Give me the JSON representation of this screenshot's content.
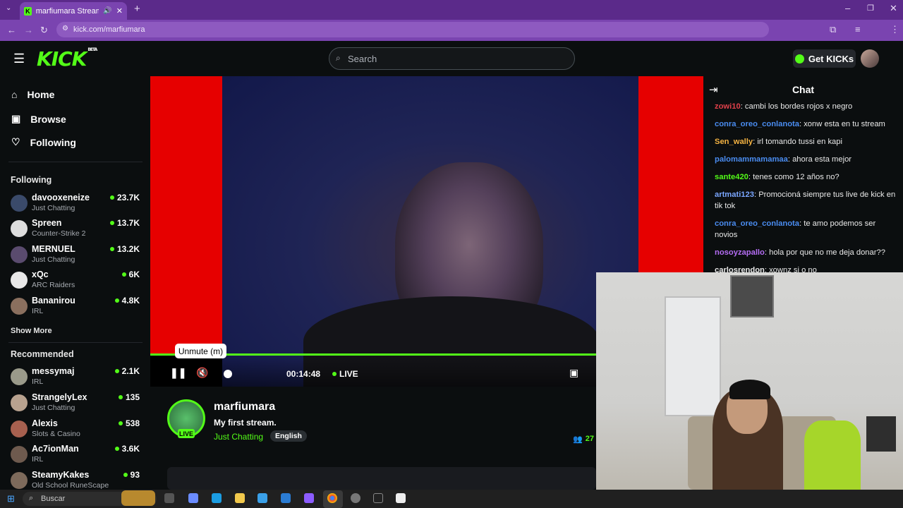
{
  "browser": {
    "tab_title": "marfiumara Stream - Watch",
    "url": "kick.com/marfiumara"
  },
  "header": {
    "logo": "KICK",
    "logo_badge": "BETA",
    "search_placeholder": "Search",
    "get_kicks": "Get KICKs"
  },
  "sidebar": {
    "nav": [
      {
        "label": "Home",
        "icon": "home-icon"
      },
      {
        "label": "Browse",
        "icon": "browse-icon"
      },
      {
        "label": "Following",
        "icon": "heart-icon"
      }
    ],
    "following_title": "Following",
    "following": [
      {
        "name": "davooxeneize",
        "category": "Just Chatting",
        "viewers": "23.7K"
      },
      {
        "name": "Spreen",
        "category": "Counter-Strike 2",
        "viewers": "13.7K"
      },
      {
        "name": "MERNUEL",
        "category": "Just Chatting",
        "viewers": "13.2K"
      },
      {
        "name": "xQc",
        "category": "ARC Raiders",
        "viewers": "6K"
      },
      {
        "name": "Bananirou",
        "category": "IRL",
        "viewers": "4.8K"
      }
    ],
    "show_more": "Show More",
    "recommended_title": "Recommended",
    "recommended": [
      {
        "name": "messymaj",
        "category": "IRL",
        "viewers": "2.1K"
      },
      {
        "name": "StrangelyLex",
        "category": "Just Chatting",
        "viewers": "135"
      },
      {
        "name": "Alexis",
        "category": "Slots & Casino",
        "viewers": "538"
      },
      {
        "name": "Ac7ionMan",
        "category": "IRL",
        "viewers": "3.6K"
      },
      {
        "name": "SteamyKakes",
        "category": "Old School RuneScape",
        "viewers": "93"
      }
    ]
  },
  "player": {
    "tooltip": "Unmute (m)",
    "time": "00:14:48",
    "live": "LIVE",
    "progress": 1.0
  },
  "channel": {
    "name": "marfiumara",
    "title": "My first stream.",
    "category": "Just Chatting",
    "language": "English",
    "live_badge": "LIVE",
    "viewers": "27"
  },
  "chat": {
    "title": "Chat",
    "messages": [
      {
        "user": "zowi10",
        "color": "#e0404a",
        "text": ": cambi los bordes rojos x negro"
      },
      {
        "user": "conra_oreo_conlanota",
        "color": "#4a8cf0",
        "text": ": xonw esta en tu stream"
      },
      {
        "user": "Sen_wally",
        "color": "#f5b342",
        "text": ": irl tomando tussi en kapi"
      },
      {
        "user": "palomammamamaa",
        "color": "#4a8cf0",
        "text": ": ahora esta mejor"
      },
      {
        "user": "sante420",
        "color": "#53fc18",
        "text": ": tenes como 12 años no?"
      },
      {
        "user": "artmati123",
        "color": "#7aa6ff",
        "text": ": Promocioná siempre tus live de kick en tik tok"
      },
      {
        "user": "conra_oreo_conlanota",
        "color": "#4a8cf0",
        "text": ": te amo podemos ser novios"
      },
      {
        "user": "nosoyzapallo",
        "color": "#b56df5",
        "text": ": hola por que no me deja donar??"
      },
      {
        "user": "carlosrendon",
        "color": "#e9e9e9",
        "text": ": xownz si o no"
      }
    ]
  },
  "taskbar": {
    "search": "Buscar"
  }
}
